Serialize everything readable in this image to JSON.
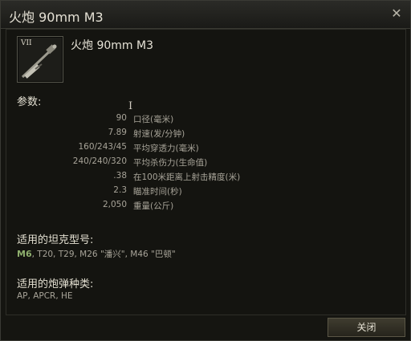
{
  "window": {
    "title": "火炮 90mm M3",
    "close_icon": "close-icon"
  },
  "module": {
    "tier": "VII",
    "name": "火炮 90mm M3",
    "icon": "gun-icon"
  },
  "params": {
    "heading": "参数:",
    "rows": [
      {
        "value": "90",
        "label": "口径(毫米)"
      },
      {
        "value": "7.89",
        "label": "射速(发/分钟)"
      },
      {
        "value": "160/243/45",
        "label": "平均穿透力(毫米)"
      },
      {
        "value": "240/240/320",
        "label": "平均杀伤力(生命值)"
      },
      {
        "value": ".38",
        "label": "在100米距离上射击精度(米)"
      },
      {
        "value": "2.3",
        "label": "瞄准时间(秒)"
      },
      {
        "value": "2,050",
        "label": "重量(公斤)"
      }
    ]
  },
  "compatible_tanks": {
    "heading": "适用的坦克型号:",
    "highlight": "M6",
    "rest": ", T20, T29, M26 \"潘兴\", M46 \"巴顿\""
  },
  "compatible_shells": {
    "heading": "适用的炮弹种类:",
    "list": "AP, APCR, HE"
  },
  "footer": {
    "close_label": "关闭"
  },
  "colors": {
    "highlight_green": "#8fb06e",
    "text": "#a7a398",
    "background": "#141410"
  }
}
